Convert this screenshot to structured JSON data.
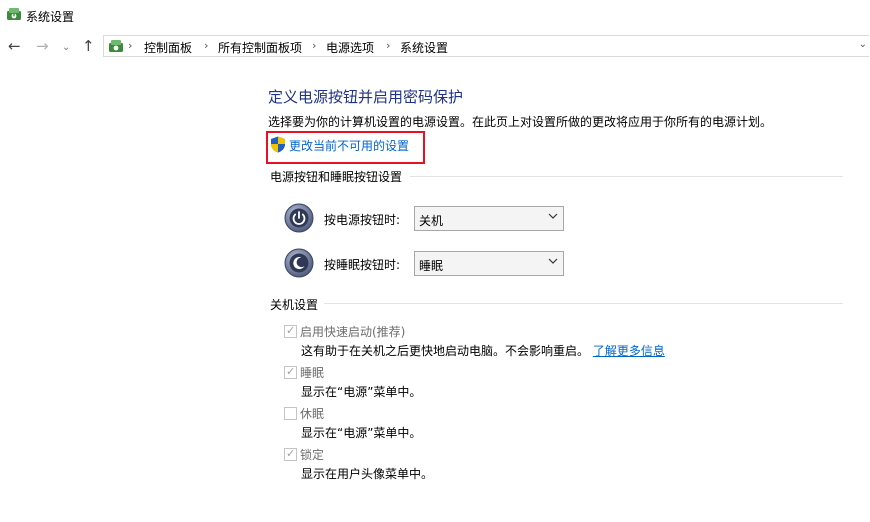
{
  "window": {
    "title": "系统设置"
  },
  "nav": {
    "breadcrumbs": [
      "控制面板",
      "所有控制面板项",
      "电源选项",
      "系统设置"
    ]
  },
  "main": {
    "title": "定义电源按钮并启用密码保护",
    "description": "选择要为你的计算机设置的电源设置。在此页上对设置所做的更改将应用于你所有的电源计划。",
    "change_link": "更改当前不可用的设置",
    "buttons_section": {
      "title": "电源按钮和睡眠按钮设置",
      "power_label": "按电源按钮时:",
      "power_value": "关机",
      "sleep_label": "按睡眠按钮时:",
      "sleep_value": "睡眠"
    },
    "shutdown_section": {
      "title": "关机设置",
      "items": [
        {
          "label": "启用快速启动(推荐)",
          "desc": "这有助于在关机之后更快地启动电脑。不会影响重启。",
          "link": "了解更多信息",
          "checked": true
        },
        {
          "label": "睡眠",
          "desc": "显示在“电源”菜单中。",
          "checked": true
        },
        {
          "label": "休眠",
          "desc": "显示在“电源”菜单中。",
          "checked": false
        },
        {
          "label": "锁定",
          "desc": "显示在用户头像菜单中。",
          "checked": true
        }
      ]
    }
  },
  "colors": {
    "title": "#1e3287",
    "link": "#0066cc",
    "highlight": "#e81123"
  }
}
